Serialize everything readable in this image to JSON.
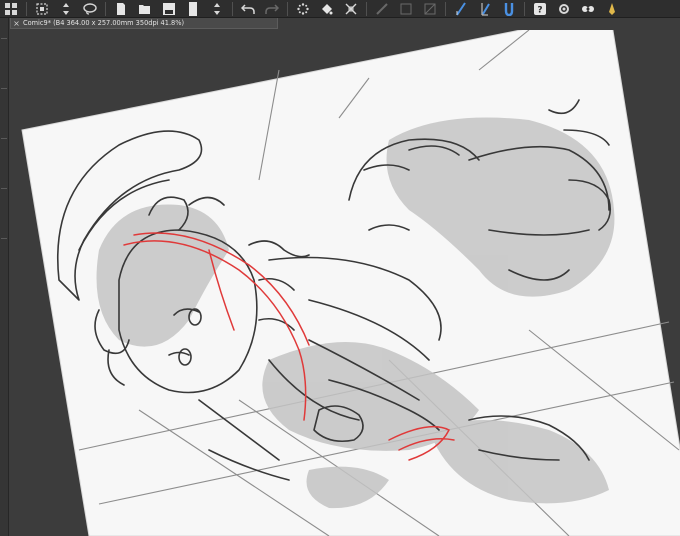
{
  "document": {
    "tab_title": "Comic9* (B4 364.00 x 257.00mm 350dpi 41.8%)",
    "close_glyph": "×"
  },
  "toolbar": {
    "icons": [
      "grid-icon",
      "selection-icon",
      "stepper-icon",
      "lasso-icon",
      "new-file-icon",
      "open-file-icon",
      "save-file-icon",
      "page-icon",
      "stepper-icon",
      "undo-icon",
      "redo-icon",
      "loading-icon",
      "fill-icon",
      "transform-icon",
      "ruler-icon",
      "disabled-icon",
      "disabled-icon",
      "pen-pressure-icon",
      "pen-tilt-icon",
      "magnet-icon",
      "help-icon",
      "settings-icon",
      "pattern-icon",
      "gold-pen-icon"
    ]
  },
  "colors": {
    "background": "#3c3c3c",
    "toolbar": "#2e2e2e",
    "paper": "#f7f7f7",
    "sketch_line": "#3a3a3a",
    "shade": "#bdbdbd",
    "accent_red": "#e03a3a",
    "tool_blue": "#4a90e2"
  }
}
